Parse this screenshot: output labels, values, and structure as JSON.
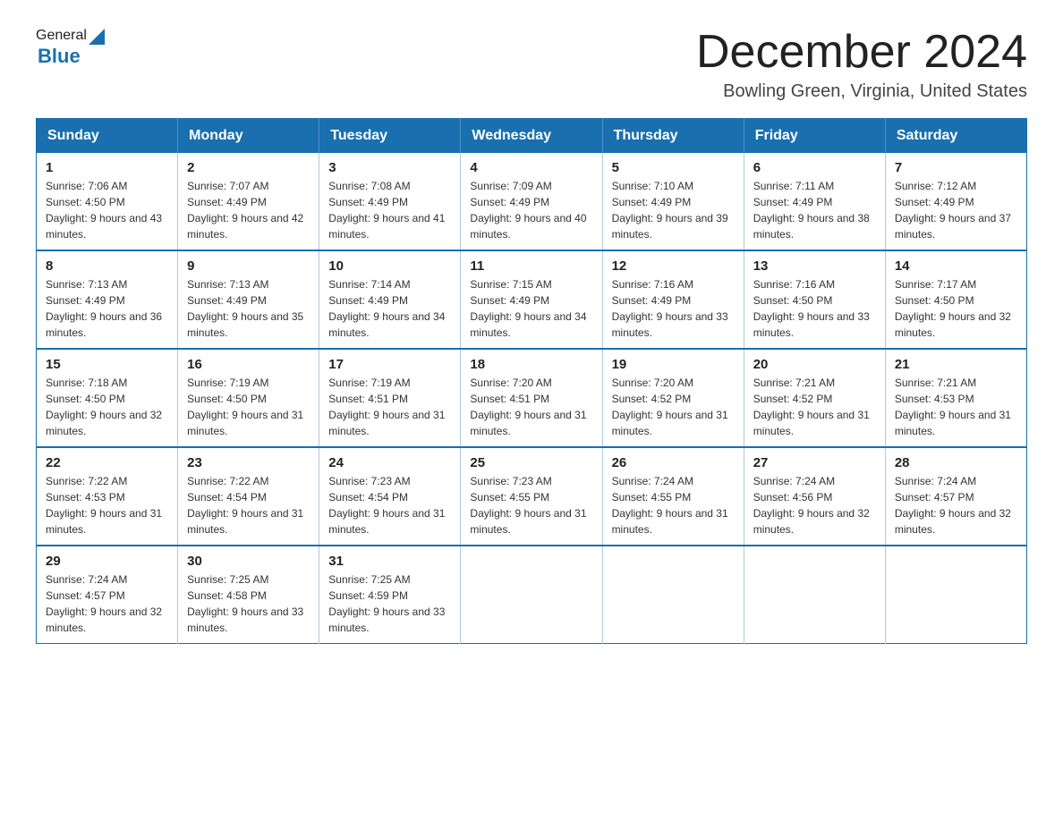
{
  "header": {
    "logo_general": "General",
    "logo_blue": "Blue",
    "month_title": "December 2024",
    "location": "Bowling Green, Virginia, United States"
  },
  "weekdays": [
    "Sunday",
    "Monday",
    "Tuesday",
    "Wednesday",
    "Thursday",
    "Friday",
    "Saturday"
  ],
  "weeks": [
    [
      {
        "day": "1",
        "sunrise": "Sunrise: 7:06 AM",
        "sunset": "Sunset: 4:50 PM",
        "daylight": "Daylight: 9 hours and 43 minutes."
      },
      {
        "day": "2",
        "sunrise": "Sunrise: 7:07 AM",
        "sunset": "Sunset: 4:49 PM",
        "daylight": "Daylight: 9 hours and 42 minutes."
      },
      {
        "day": "3",
        "sunrise": "Sunrise: 7:08 AM",
        "sunset": "Sunset: 4:49 PM",
        "daylight": "Daylight: 9 hours and 41 minutes."
      },
      {
        "day": "4",
        "sunrise": "Sunrise: 7:09 AM",
        "sunset": "Sunset: 4:49 PM",
        "daylight": "Daylight: 9 hours and 40 minutes."
      },
      {
        "day": "5",
        "sunrise": "Sunrise: 7:10 AM",
        "sunset": "Sunset: 4:49 PM",
        "daylight": "Daylight: 9 hours and 39 minutes."
      },
      {
        "day": "6",
        "sunrise": "Sunrise: 7:11 AM",
        "sunset": "Sunset: 4:49 PM",
        "daylight": "Daylight: 9 hours and 38 minutes."
      },
      {
        "day": "7",
        "sunrise": "Sunrise: 7:12 AM",
        "sunset": "Sunset: 4:49 PM",
        "daylight": "Daylight: 9 hours and 37 minutes."
      }
    ],
    [
      {
        "day": "8",
        "sunrise": "Sunrise: 7:13 AM",
        "sunset": "Sunset: 4:49 PM",
        "daylight": "Daylight: 9 hours and 36 minutes."
      },
      {
        "day": "9",
        "sunrise": "Sunrise: 7:13 AM",
        "sunset": "Sunset: 4:49 PM",
        "daylight": "Daylight: 9 hours and 35 minutes."
      },
      {
        "day": "10",
        "sunrise": "Sunrise: 7:14 AM",
        "sunset": "Sunset: 4:49 PM",
        "daylight": "Daylight: 9 hours and 34 minutes."
      },
      {
        "day": "11",
        "sunrise": "Sunrise: 7:15 AM",
        "sunset": "Sunset: 4:49 PM",
        "daylight": "Daylight: 9 hours and 34 minutes."
      },
      {
        "day": "12",
        "sunrise": "Sunrise: 7:16 AM",
        "sunset": "Sunset: 4:49 PM",
        "daylight": "Daylight: 9 hours and 33 minutes."
      },
      {
        "day": "13",
        "sunrise": "Sunrise: 7:16 AM",
        "sunset": "Sunset: 4:50 PM",
        "daylight": "Daylight: 9 hours and 33 minutes."
      },
      {
        "day": "14",
        "sunrise": "Sunrise: 7:17 AM",
        "sunset": "Sunset: 4:50 PM",
        "daylight": "Daylight: 9 hours and 32 minutes."
      }
    ],
    [
      {
        "day": "15",
        "sunrise": "Sunrise: 7:18 AM",
        "sunset": "Sunset: 4:50 PM",
        "daylight": "Daylight: 9 hours and 32 minutes."
      },
      {
        "day": "16",
        "sunrise": "Sunrise: 7:19 AM",
        "sunset": "Sunset: 4:50 PM",
        "daylight": "Daylight: 9 hours and 31 minutes."
      },
      {
        "day": "17",
        "sunrise": "Sunrise: 7:19 AM",
        "sunset": "Sunset: 4:51 PM",
        "daylight": "Daylight: 9 hours and 31 minutes."
      },
      {
        "day": "18",
        "sunrise": "Sunrise: 7:20 AM",
        "sunset": "Sunset: 4:51 PM",
        "daylight": "Daylight: 9 hours and 31 minutes."
      },
      {
        "day": "19",
        "sunrise": "Sunrise: 7:20 AM",
        "sunset": "Sunset: 4:52 PM",
        "daylight": "Daylight: 9 hours and 31 minutes."
      },
      {
        "day": "20",
        "sunrise": "Sunrise: 7:21 AM",
        "sunset": "Sunset: 4:52 PM",
        "daylight": "Daylight: 9 hours and 31 minutes."
      },
      {
        "day": "21",
        "sunrise": "Sunrise: 7:21 AM",
        "sunset": "Sunset: 4:53 PM",
        "daylight": "Daylight: 9 hours and 31 minutes."
      }
    ],
    [
      {
        "day": "22",
        "sunrise": "Sunrise: 7:22 AM",
        "sunset": "Sunset: 4:53 PM",
        "daylight": "Daylight: 9 hours and 31 minutes."
      },
      {
        "day": "23",
        "sunrise": "Sunrise: 7:22 AM",
        "sunset": "Sunset: 4:54 PM",
        "daylight": "Daylight: 9 hours and 31 minutes."
      },
      {
        "day": "24",
        "sunrise": "Sunrise: 7:23 AM",
        "sunset": "Sunset: 4:54 PM",
        "daylight": "Daylight: 9 hours and 31 minutes."
      },
      {
        "day": "25",
        "sunrise": "Sunrise: 7:23 AM",
        "sunset": "Sunset: 4:55 PM",
        "daylight": "Daylight: 9 hours and 31 minutes."
      },
      {
        "day": "26",
        "sunrise": "Sunrise: 7:24 AM",
        "sunset": "Sunset: 4:55 PM",
        "daylight": "Daylight: 9 hours and 31 minutes."
      },
      {
        "day": "27",
        "sunrise": "Sunrise: 7:24 AM",
        "sunset": "Sunset: 4:56 PM",
        "daylight": "Daylight: 9 hours and 32 minutes."
      },
      {
        "day": "28",
        "sunrise": "Sunrise: 7:24 AM",
        "sunset": "Sunset: 4:57 PM",
        "daylight": "Daylight: 9 hours and 32 minutes."
      }
    ],
    [
      {
        "day": "29",
        "sunrise": "Sunrise: 7:24 AM",
        "sunset": "Sunset: 4:57 PM",
        "daylight": "Daylight: 9 hours and 32 minutes."
      },
      {
        "day": "30",
        "sunrise": "Sunrise: 7:25 AM",
        "sunset": "Sunset: 4:58 PM",
        "daylight": "Daylight: 9 hours and 33 minutes."
      },
      {
        "day": "31",
        "sunrise": "Sunrise: 7:25 AM",
        "sunset": "Sunset: 4:59 PM",
        "daylight": "Daylight: 9 hours and 33 minutes."
      },
      null,
      null,
      null,
      null
    ]
  ]
}
